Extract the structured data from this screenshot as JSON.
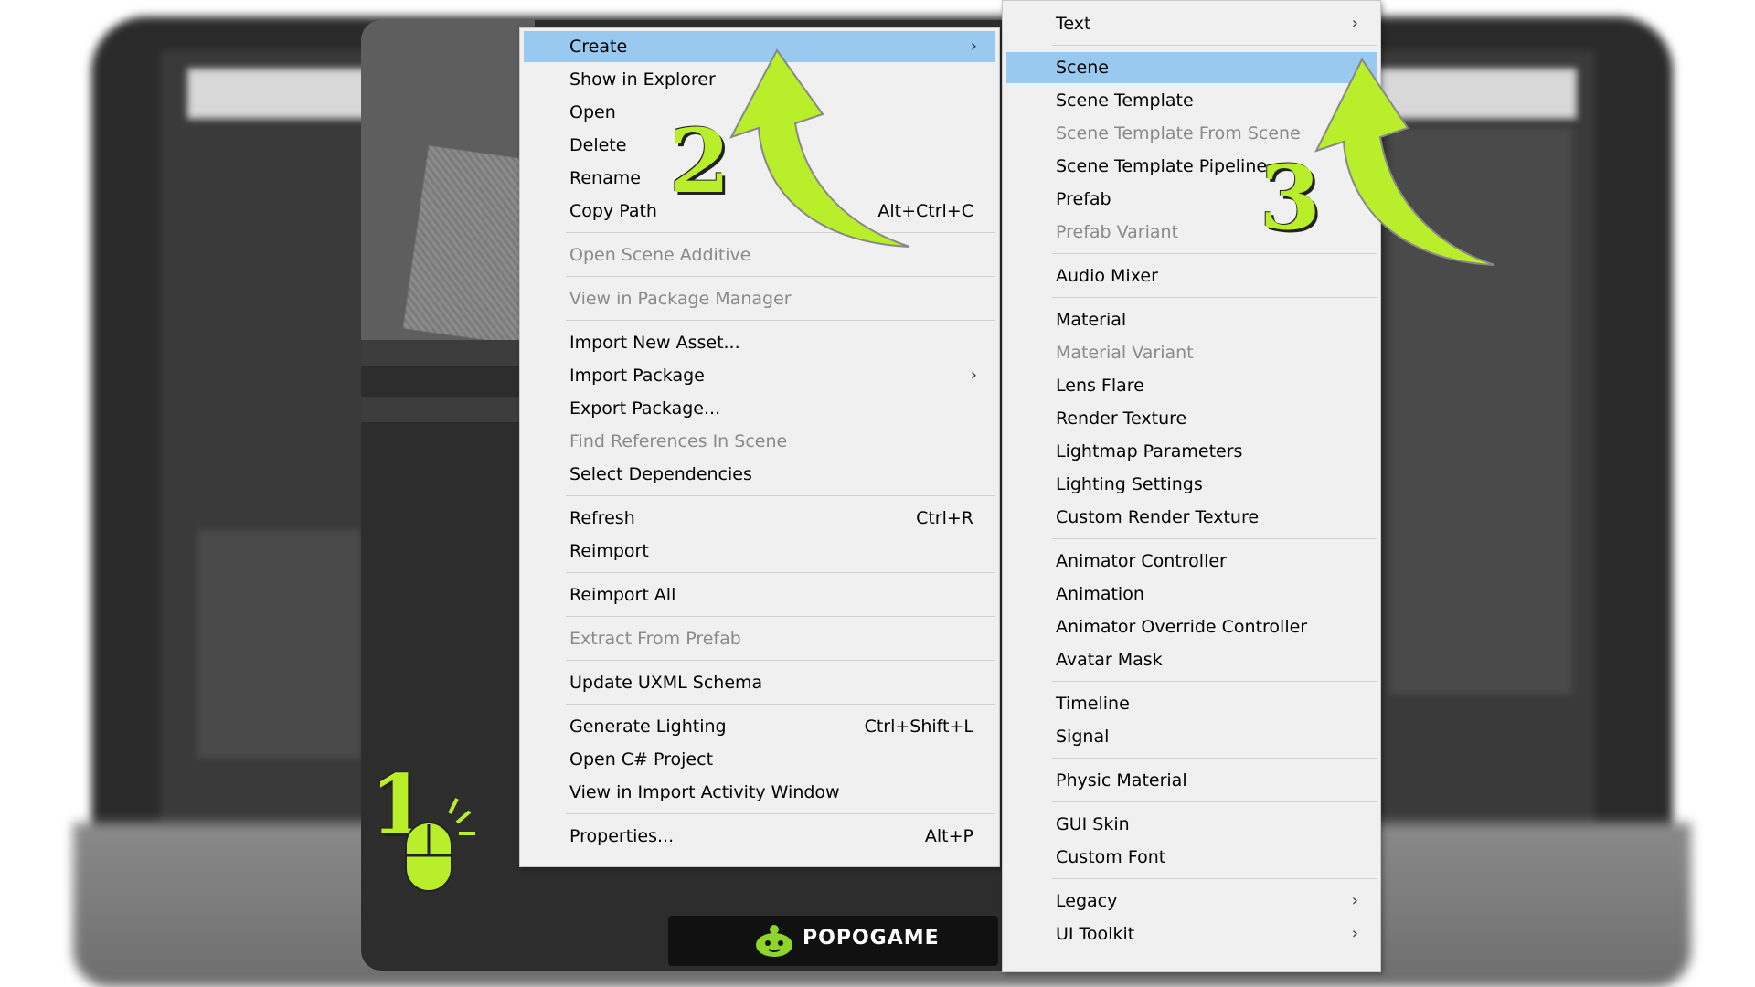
{
  "menu": {
    "items": [
      {
        "label": "Create",
        "shortcut": "",
        "submenu": true,
        "highlighted": true,
        "disabled": false
      },
      {
        "label": "Show in Explorer",
        "shortcut": "",
        "submenu": false,
        "highlighted": false,
        "disabled": false
      },
      {
        "label": "Open",
        "shortcut": "",
        "submenu": false,
        "highlighted": false,
        "disabled": false
      },
      {
        "label": "Delete",
        "shortcut": "",
        "submenu": false,
        "highlighted": false,
        "disabled": false
      },
      {
        "label": "Rename",
        "shortcut": "",
        "submenu": false,
        "highlighted": false,
        "disabled": false
      },
      {
        "label": "Copy Path",
        "shortcut": "Alt+Ctrl+C",
        "submenu": false,
        "highlighted": false,
        "disabled": false
      },
      {
        "label": "Open Scene Additive",
        "shortcut": "",
        "submenu": false,
        "highlighted": false,
        "disabled": true
      },
      {
        "label": "View in Package Manager",
        "shortcut": "",
        "submenu": false,
        "highlighted": false,
        "disabled": true
      },
      {
        "label": "Import New Asset...",
        "shortcut": "",
        "submenu": false,
        "highlighted": false,
        "disabled": false
      },
      {
        "label": "Import Package",
        "shortcut": "",
        "submenu": true,
        "highlighted": false,
        "disabled": false
      },
      {
        "label": "Export Package...",
        "shortcut": "",
        "submenu": false,
        "highlighted": false,
        "disabled": false
      },
      {
        "label": "Find References In Scene",
        "shortcut": "",
        "submenu": false,
        "highlighted": false,
        "disabled": true
      },
      {
        "label": "Select Dependencies",
        "shortcut": "",
        "submenu": false,
        "highlighted": false,
        "disabled": false
      },
      {
        "label": "Refresh",
        "shortcut": "Ctrl+R",
        "submenu": false,
        "highlighted": false,
        "disabled": false
      },
      {
        "label": "Reimport",
        "shortcut": "",
        "submenu": false,
        "highlighted": false,
        "disabled": false
      },
      {
        "label": "Reimport All",
        "shortcut": "",
        "submenu": false,
        "highlighted": false,
        "disabled": false
      },
      {
        "label": "Extract From Prefab",
        "shortcut": "",
        "submenu": false,
        "highlighted": false,
        "disabled": true
      },
      {
        "label": "Update UXML Schema",
        "shortcut": "",
        "submenu": false,
        "highlighted": false,
        "disabled": false
      },
      {
        "label": "Generate Lighting",
        "shortcut": "Ctrl+Shift+L",
        "submenu": false,
        "highlighted": false,
        "disabled": false
      },
      {
        "label": "Open C# Project",
        "shortcut": "",
        "submenu": false,
        "highlighted": false,
        "disabled": false
      },
      {
        "label": "View in Import Activity Window",
        "shortcut": "",
        "submenu": false,
        "highlighted": false,
        "disabled": false
      },
      {
        "label": "Properties...",
        "shortcut": "Alt+P",
        "submenu": false,
        "highlighted": false,
        "disabled": false
      }
    ]
  },
  "submenu": {
    "items": [
      {
        "label": "Text",
        "submenu": true,
        "highlighted": false,
        "disabled": false
      },
      {
        "label": "Scene",
        "submenu": false,
        "highlighted": true,
        "disabled": false
      },
      {
        "label": "Scene Template",
        "submenu": false,
        "highlighted": false,
        "disabled": false
      },
      {
        "label": "Scene Template From Scene",
        "submenu": false,
        "highlighted": false,
        "disabled": true
      },
      {
        "label": "Scene Template Pipeline",
        "submenu": false,
        "highlighted": false,
        "disabled": false
      },
      {
        "label": "Prefab",
        "submenu": false,
        "highlighted": false,
        "disabled": false
      },
      {
        "label": "Prefab Variant",
        "submenu": false,
        "highlighted": false,
        "disabled": true
      },
      {
        "label": "Audio Mixer",
        "submenu": false,
        "highlighted": false,
        "disabled": false
      },
      {
        "label": "Material",
        "submenu": false,
        "highlighted": false,
        "disabled": false
      },
      {
        "label": "Material Variant",
        "submenu": false,
        "highlighted": false,
        "disabled": true
      },
      {
        "label": "Lens Flare",
        "submenu": false,
        "highlighted": false,
        "disabled": false
      },
      {
        "label": "Render Texture",
        "submenu": false,
        "highlighted": false,
        "disabled": false
      },
      {
        "label": "Lightmap Parameters",
        "submenu": false,
        "highlighted": false,
        "disabled": false
      },
      {
        "label": "Lighting Settings",
        "submenu": false,
        "highlighted": false,
        "disabled": false
      },
      {
        "label": "Custom Render Texture",
        "submenu": false,
        "highlighted": false,
        "disabled": false
      },
      {
        "label": "Animator Controller",
        "submenu": false,
        "highlighted": false,
        "disabled": false
      },
      {
        "label": "Animation",
        "submenu": false,
        "highlighted": false,
        "disabled": false
      },
      {
        "label": "Animator Override Controller",
        "submenu": false,
        "highlighted": false,
        "disabled": false
      },
      {
        "label": "Avatar Mask",
        "submenu": false,
        "highlighted": false,
        "disabled": false
      },
      {
        "label": "Timeline",
        "submenu": false,
        "highlighted": false,
        "disabled": false
      },
      {
        "label": "Signal",
        "submenu": false,
        "highlighted": false,
        "disabled": false
      },
      {
        "label": "Physic Material",
        "submenu": false,
        "highlighted": false,
        "disabled": false
      },
      {
        "label": "GUI Skin",
        "submenu": false,
        "highlighted": false,
        "disabled": false
      },
      {
        "label": "Custom Font",
        "submenu": false,
        "highlighted": false,
        "disabled": false
      },
      {
        "label": "Legacy",
        "submenu": true,
        "highlighted": false,
        "disabled": false
      },
      {
        "label": "UI Toolkit",
        "submenu": true,
        "highlighted": false,
        "disabled": false
      }
    ]
  },
  "annotations": {
    "step1": "1",
    "step2": "2",
    "step3": "3"
  },
  "brand": {
    "text": "POPOGAME"
  },
  "colors": {
    "highlight": "#99c9ef",
    "accent": "#b8ef2a",
    "disabled_text": "#8a8a8a"
  },
  "icons": {
    "submenu_arrow": "chevron-right-icon",
    "mouse": "mouse-click-icon",
    "brand_logo": "robot-logo-icon"
  }
}
